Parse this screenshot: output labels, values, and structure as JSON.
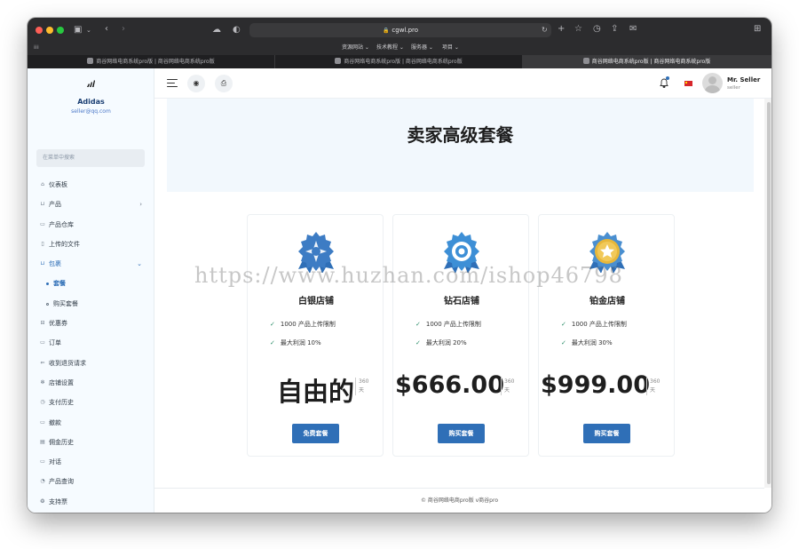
{
  "browser": {
    "url": "cgwl.pro",
    "bookmarks": [
      "资源网站 ⌄",
      "技术教程 ⌄",
      "服务器 ⌄",
      "项目 ⌄"
    ],
    "tabs": [
      {
        "label": "商谷网络电商系统pro版 | 商谷网络电商系统pro版",
        "active": false
      },
      {
        "label": "商谷网络电商系统pro版 | 商谷网络电商系统pro版",
        "active": false
      },
      {
        "label": "商谷网络电商系统pro版 | 商谷网络电商系统pro版",
        "active": true
      }
    ]
  },
  "sidebar": {
    "brand_name": "Adidas",
    "brand_email": "seller@qq.com",
    "search_placeholder": "在菜单中搜索",
    "items": [
      {
        "label": "仪表板",
        "icon": "home-icon"
      },
      {
        "label": "产品",
        "icon": "cart-icon",
        "chevron": "›"
      },
      {
        "label": "产品仓库",
        "icon": "inbox-icon"
      },
      {
        "label": "上传的文件",
        "icon": "folder-icon"
      },
      {
        "label": "包裹",
        "icon": "cart-icon",
        "chevron": "⌄"
      },
      {
        "label": "套餐",
        "sub": true,
        "active": true
      },
      {
        "label": "购买套餐",
        "sub": true
      },
      {
        "label": "优惠券",
        "icon": "ticket-icon"
      },
      {
        "label": "订单",
        "icon": "money-icon"
      },
      {
        "label": "收到退货请求",
        "icon": "return-icon"
      },
      {
        "label": "店铺设置",
        "icon": "gear-icon"
      },
      {
        "label": "支付历史",
        "icon": "history-icon"
      },
      {
        "label": "撤款",
        "icon": "wallet-icon"
      },
      {
        "label": "佣金历史",
        "icon": "document-icon"
      },
      {
        "label": "对话",
        "icon": "chat-icon"
      },
      {
        "label": "产品查询",
        "icon": "question-icon"
      },
      {
        "label": "支持票",
        "icon": "support-icon"
      }
    ]
  },
  "topbar": {
    "user_name": "Mr. Seller",
    "user_role": "seller"
  },
  "main": {
    "title": "卖家高级套餐",
    "packages": [
      {
        "name": "白银店铺",
        "features": [
          "1000 产品上传限制",
          "最大利润 10%"
        ],
        "price": "自由的",
        "period": [
          "360",
          "天"
        ],
        "button": "免费套餐",
        "badge_color": "#3d7cc4"
      },
      {
        "name": "钻石店铺",
        "features": [
          "1000 产品上传限制",
          "最大利润 20%"
        ],
        "price": "$666.00",
        "period": [
          "360",
          "天"
        ],
        "button": "购买套餐",
        "badge_color": "#3d8fd6"
      },
      {
        "name": "铂金店铺",
        "features": [
          "1000 产品上传限制",
          "最大利润 30%"
        ],
        "price": "$999.00",
        "period": [
          "360",
          "天"
        ],
        "button": "购买套餐",
        "badge_color": "#e7b73a"
      }
    ],
    "footer": "© 商谷网络电商pro版 v商谷pro"
  },
  "watermark": "https://www.huzhan.com/ishop46798",
  "colors": {
    "accent": "#2f6fb7",
    "brand": "#1b3f73"
  }
}
